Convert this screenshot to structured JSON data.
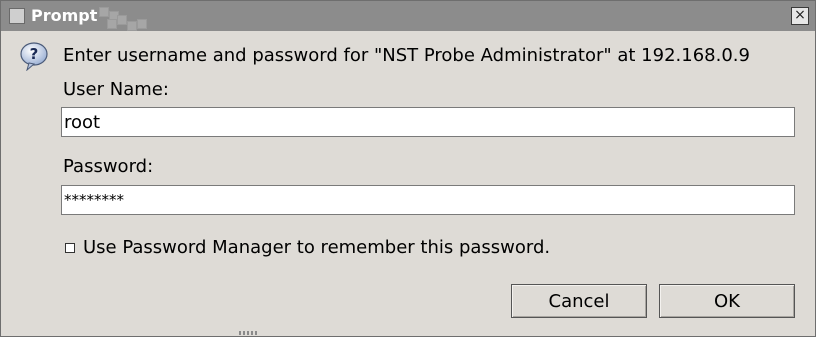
{
  "window": {
    "title": "Prompt",
    "close_glyph": "×"
  },
  "dialog": {
    "icon": "question-icon",
    "message": "Enter username and password for \"NST Probe Administrator\" at 192.168.0.9",
    "username_label": "User Name:",
    "username_value": "root",
    "password_label": "Password:",
    "password_value": "********",
    "remember_label": "Use Password Manager to remember this password.",
    "remember_checked": false,
    "cancel_label": "Cancel",
    "ok_label": "OK"
  },
  "colors": {
    "titlebar": "#8c8c8c",
    "background": "#dedbd6",
    "field_background": "#ffffff"
  }
}
